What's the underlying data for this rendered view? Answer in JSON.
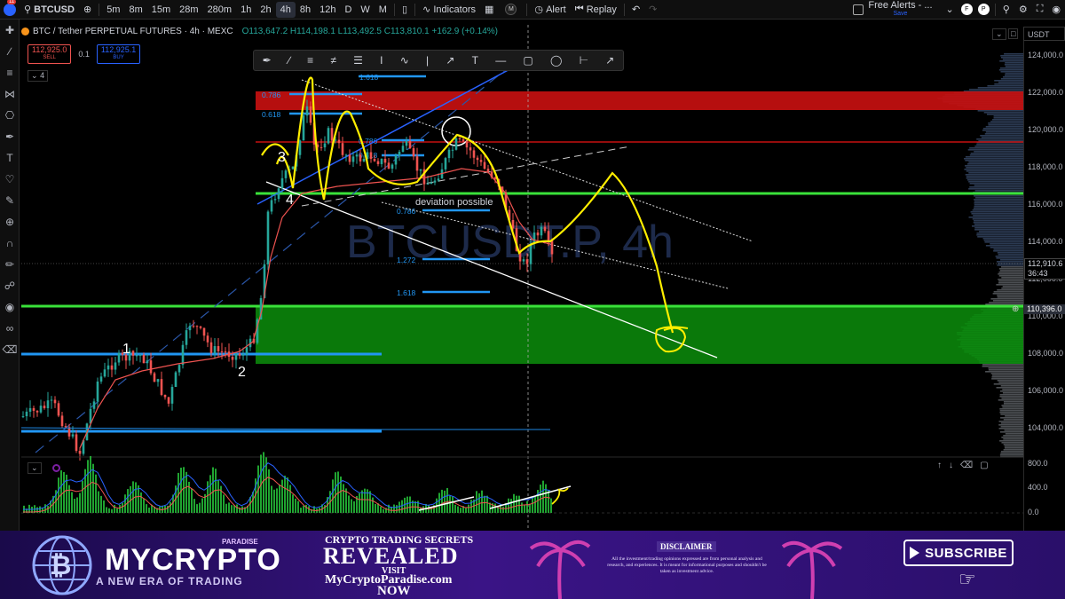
{
  "topbar": {
    "symbol": "BTCUSD",
    "timeframes": [
      "5m",
      "8m",
      "15m",
      "28m",
      "280m",
      "1h",
      "2h",
      "4h",
      "8h",
      "12h",
      "D",
      "W",
      "M"
    ],
    "active_timeframe": "4h",
    "indicators_label": "Indicators",
    "alert_label": "Alert",
    "replay_label": "Replay",
    "free_alerts_label": "Free Alerts - ...",
    "save_label": "Save",
    "profile_initials": [
      "F",
      "P"
    ]
  },
  "legend": {
    "title": "BTC / Tether PERPETUAL FUTURES · 4h · MEXC",
    "ohlc": "O113,647.2 H114,198.1 L113,492.5 C113,810.1 +162.9 (+0.14%)",
    "sell_price": "112,925.0",
    "sell_label": "SELL",
    "spread": "0.1",
    "buy_price": "112,925.1",
    "buy_label": "BUY",
    "collapsed_count": "4"
  },
  "watermark": "BTCUSDT.P, 4h",
  "price_axis": {
    "currency": "USDT",
    "ticks": [
      "124,000.0",
      "122,000.0",
      "120,000.0",
      "118,000.0",
      "116,000.0",
      "114,000.0",
      "112,000.0",
      "110,000.0",
      "108,000.0",
      "106,000.0",
      "104,000.0"
    ],
    "current_price": "112,910.6",
    "countdown": "36:43",
    "crosshair_price": "110,396.0"
  },
  "fib_labels": [
    "1.618",
    "0.786",
    "0.618",
    "0.786",
    "0.618",
    "0.786",
    "1.272",
    "1.618"
  ],
  "annotations": {
    "wave_labels": [
      "1",
      "2",
      "3",
      "4"
    ],
    "note": "deviation possible"
  },
  "oscillator_axis": [
    "800.0",
    "400.0",
    "0.0"
  ],
  "colors": {
    "up": "#26a69a",
    "down": "#ef5350",
    "green_zone": "#0b8a0b",
    "red_zone": "#d11212",
    "pen": "#ffee00",
    "fib_blue": "#2196f3"
  },
  "banner": {
    "brand_prefix": "MY",
    "brand_main": "CRYPTO",
    "brand_paradise": "PARADISE",
    "brand_sub": "A NEW ERA OF TRADING",
    "secrets": "CRYPTO TRADING SECRETS",
    "revealed": "REVEALED",
    "visit": "VISIT",
    "url": "MyCryptoParadise.com",
    "now": "NOW",
    "disclaimer_title": "DISCLAIMER",
    "disclaimer_text": "All the investment/trading opinions expressed are from personal analysis and research, and experiences. It is meant for informational purposes and shouldn't be taken as investment advice.",
    "subscribe": "SUBSCRIBE"
  }
}
